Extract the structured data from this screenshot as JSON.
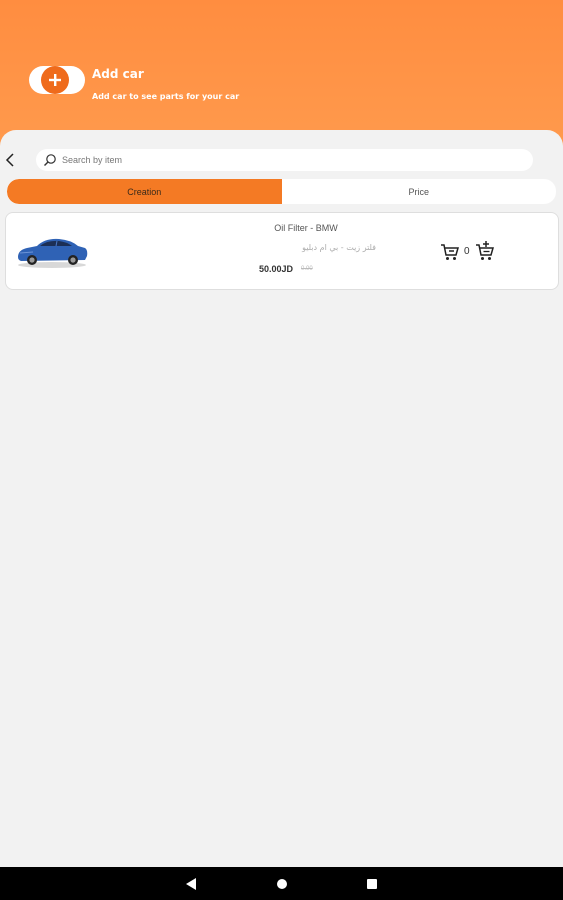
{
  "header": {
    "title": "Add car",
    "subtitle": "Add car to see parts for your car",
    "accent_color": "#ff9a4d",
    "add_icon": "plus-icon"
  },
  "search": {
    "placeholder": "Search by item",
    "back_icon": "chevron-left-icon",
    "search_icon": "search-icon"
  },
  "sort_tabs": [
    {
      "label": "Creation",
      "active": true
    },
    {
      "label": "Price",
      "active": false
    }
  ],
  "products": [
    {
      "name": "Oil Filter - BMW",
      "name_ar": "فلتر زيت - بي ام دبليو",
      "price": "50.00JD",
      "old_price": "0.00",
      "quantity": "0",
      "image": "blue-sedan-car"
    }
  ],
  "system_nav": {
    "back_icon": "triangle-back-icon",
    "home_icon": "circle-home-icon",
    "recents_icon": "square-recents-icon"
  }
}
